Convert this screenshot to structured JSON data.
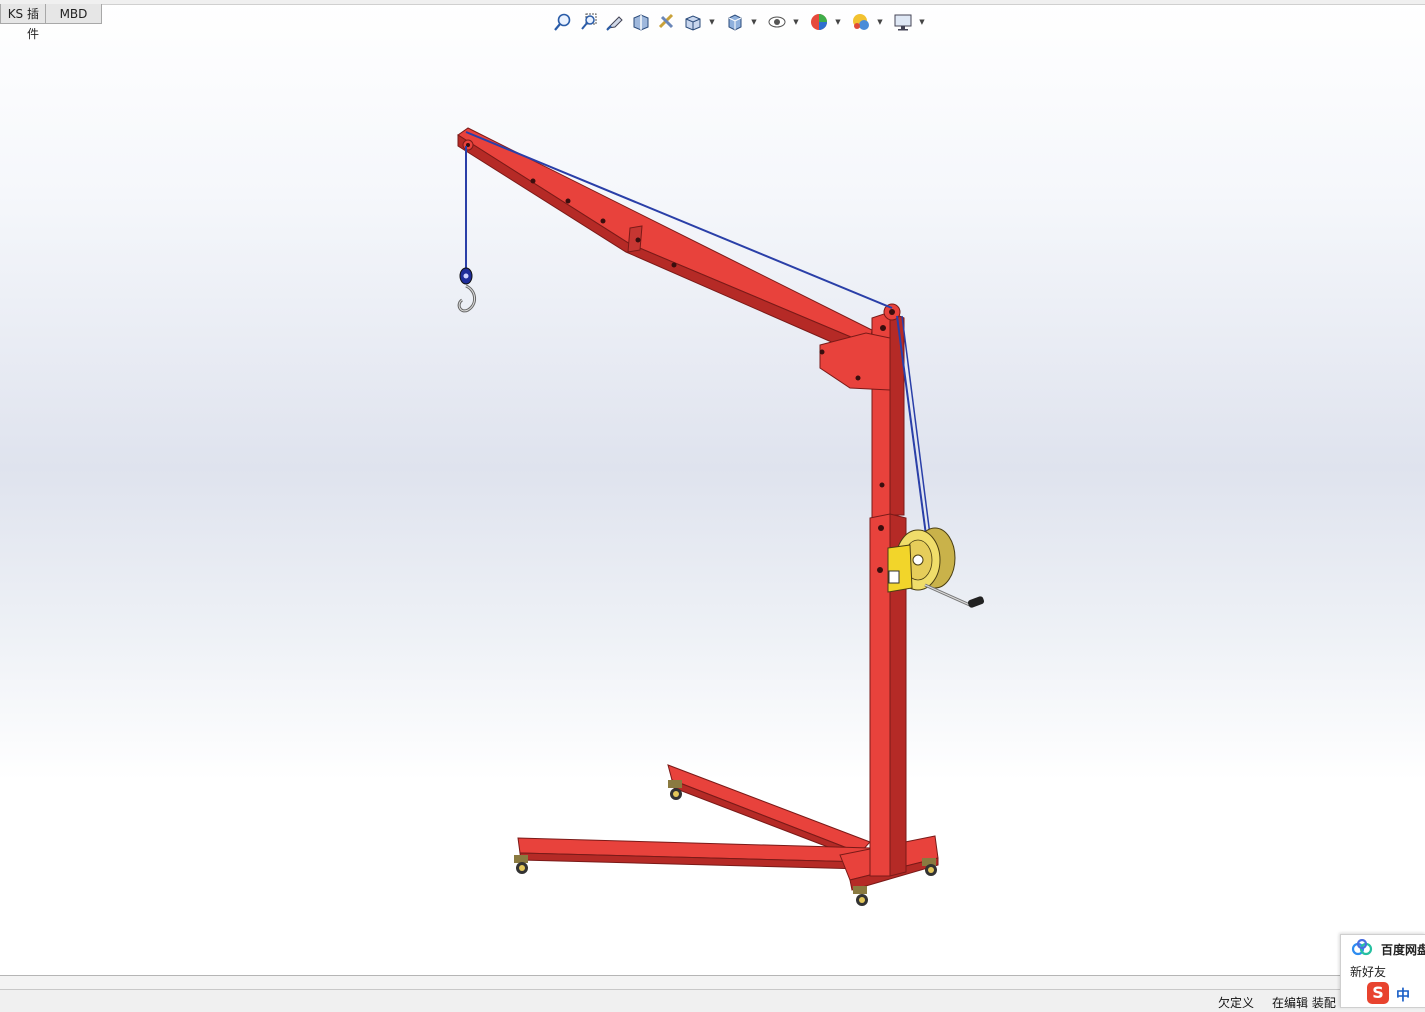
{
  "tabs": [
    {
      "label": "KS 插件"
    },
    {
      "label": "MBD"
    }
  ],
  "view_toolbar": {
    "icons": [
      "zoom-to-fit-icon",
      "zoom-to-area-icon",
      "previous-view-icon",
      "section-view-icon",
      "dynamic-annotation-icon",
      "view-orientation-icon",
      "display-style-icon",
      "hide-show-items-icon",
      "edit-appearance-icon",
      "apply-scene-icon",
      "view-settings-icon"
    ]
  },
  "status_bar": {
    "underdefined": "欠定义",
    "editing": "在编辑 装配"
  },
  "notification": {
    "title": "百度网盘",
    "subtitle": "新好友",
    "ime_logo": "S",
    "ime_mode": "中"
  },
  "colors": {
    "frame_red": "#e8423c",
    "frame_red_dark": "#b52a26",
    "cable_blue": "#2a3fa8",
    "winch_yellow": "#f0dd6a"
  }
}
